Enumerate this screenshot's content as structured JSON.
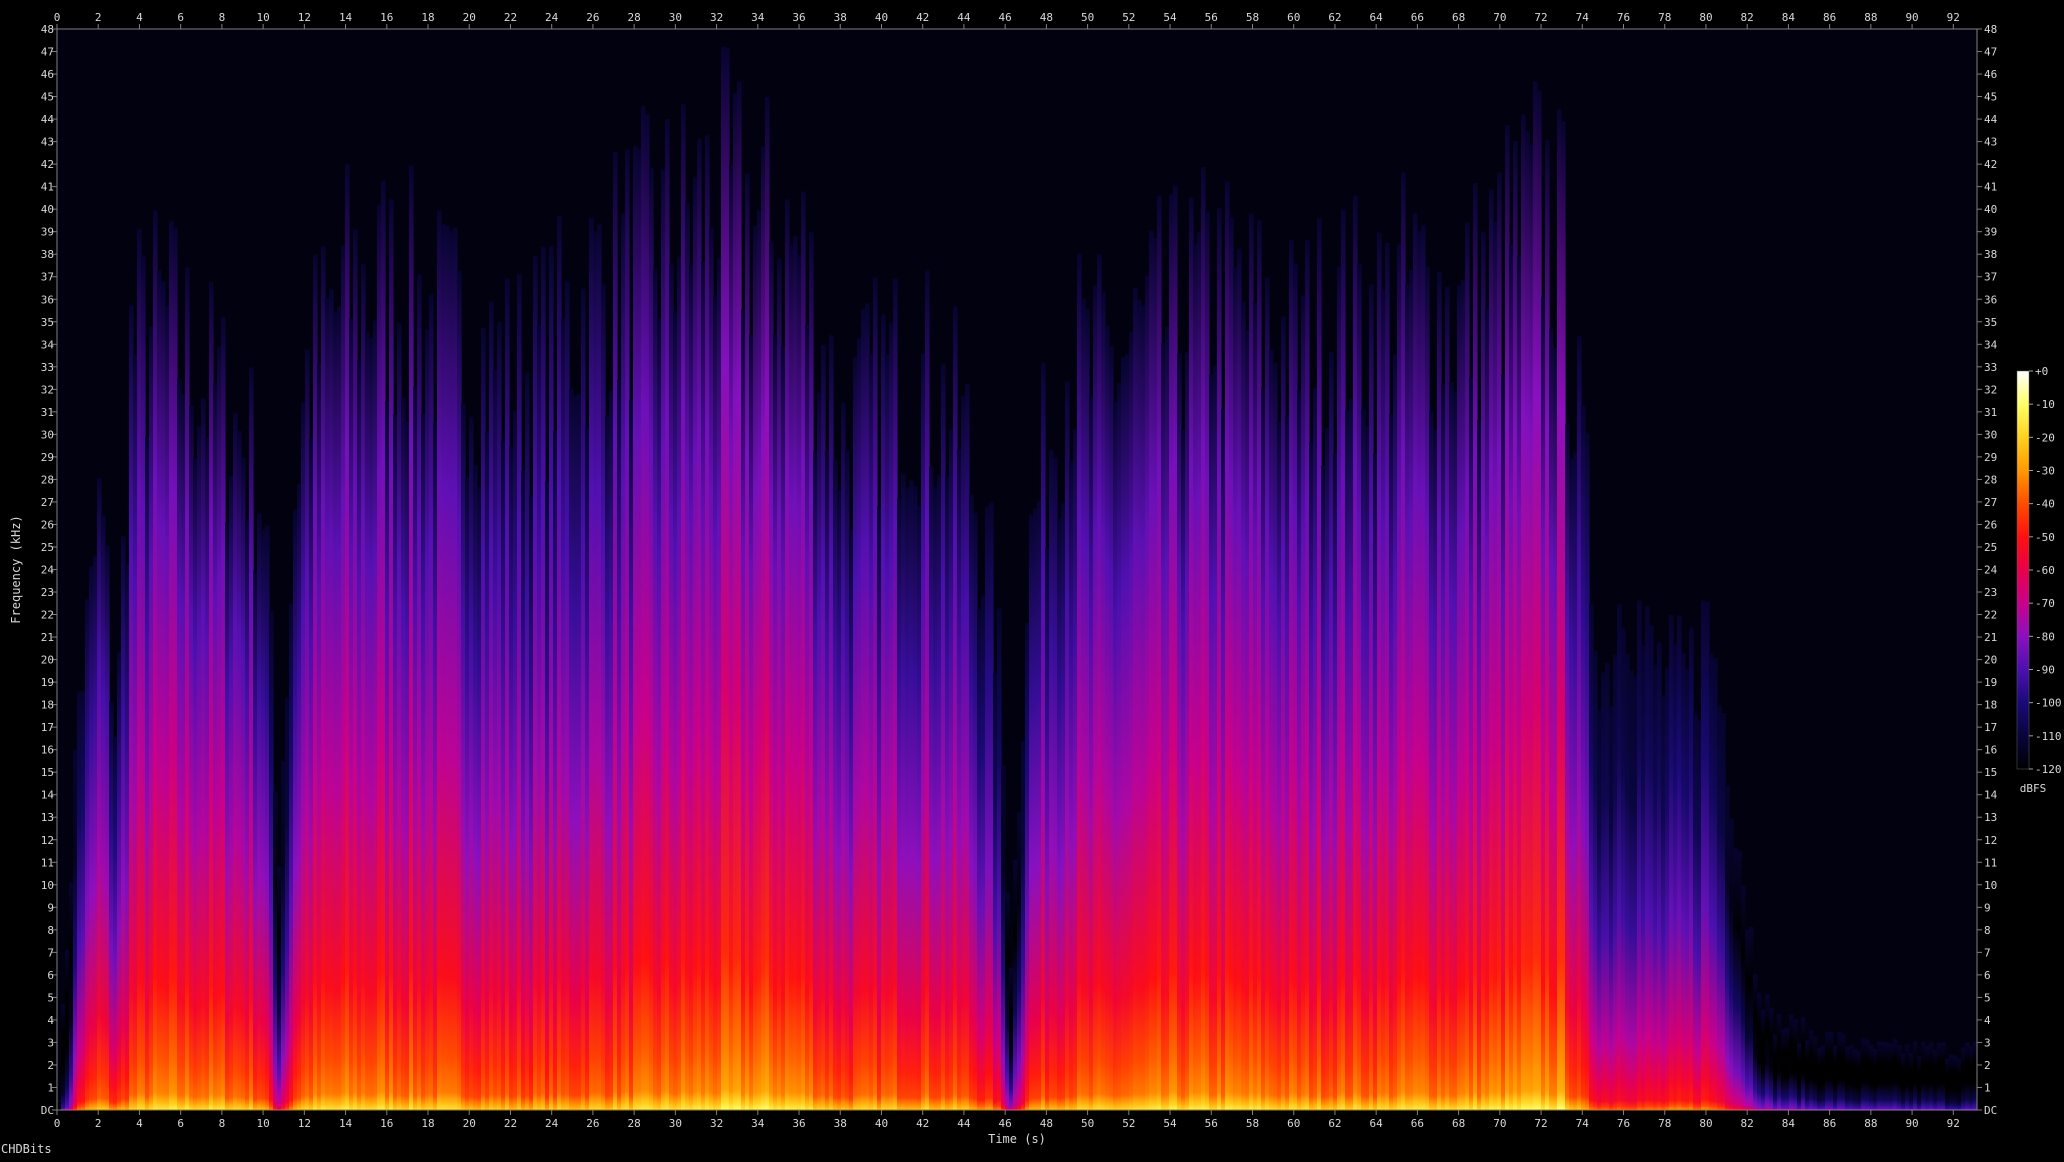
{
  "chart_data": {
    "type": "heatmap",
    "title": "",
    "xlabel": "Time (s)",
    "ylabel": "Frequency (kHz)",
    "xlim": [
      0,
      93
    ],
    "ylim": [
      0,
      48
    ],
    "x_ticks": [
      "0",
      "2",
      "4",
      "6",
      "8",
      "10",
      "12",
      "14",
      "16",
      "18",
      "20",
      "22",
      "24",
      "26",
      "28",
      "30",
      "32",
      "34",
      "36",
      "38",
      "40",
      "42",
      "44",
      "46",
      "48",
      "50",
      "52",
      "54",
      "56",
      "58",
      "60",
      "62",
      "64",
      "66",
      "68",
      "70",
      "72",
      "74",
      "76",
      "78",
      "80",
      "82",
      "84",
      "86",
      "88",
      "90",
      "92"
    ],
    "y_ticks": [
      "DC",
      "1",
      "2",
      "3",
      "4",
      "5",
      "6",
      "7",
      "8",
      "9",
      "10",
      "11",
      "12",
      "13",
      "14",
      "15",
      "16",
      "17",
      "18",
      "19",
      "20",
      "21",
      "22",
      "23",
      "24",
      "25",
      "26",
      "27",
      "28",
      "29",
      "30",
      "31",
      "32",
      "33",
      "34",
      "35",
      "36",
      "37",
      "38",
      "39",
      "40",
      "41",
      "42",
      "43",
      "44",
      "45",
      "46",
      "47",
      "48"
    ],
    "colorbar": {
      "label": "dBFS",
      "range": [
        -120,
        0
      ],
      "ticks": [
        "+0",
        "-10",
        "-20",
        "-30",
        "-40",
        "-50",
        "-60",
        "-70",
        "-80",
        "-90",
        "-100",
        "-110",
        "-120"
      ],
      "colors": [
        "#ffffff",
        "#ffff66",
        "#ffd21e",
        "#ff9a00",
        "#ff4c00",
        "#ff1010",
        "#e8004a",
        "#c8008c",
        "#8a10c0",
        "#4c10b0",
        "#1a0a78",
        "#08053a",
        "#000000"
      ]
    },
    "energy_profile": {
      "time_s": [
        0,
        1,
        1.5,
        2,
        2.8,
        3.5,
        5,
        7,
        9,
        10,
        10.6,
        11.5,
        12,
        14,
        16,
        18,
        20,
        22,
        24,
        26,
        28,
        30,
        32,
        34,
        36,
        38,
        40,
        42,
        44,
        45.5,
        46.2,
        47,
        48,
        49,
        50,
        52,
        54,
        56,
        58,
        60,
        62,
        64,
        66,
        68,
        70,
        72,
        73,
        74,
        75,
        76,
        77,
        78,
        79,
        80,
        81,
        82,
        83,
        85,
        88,
        90,
        93
      ],
      "top_khz": [
        0.4,
        14,
        16,
        20,
        12,
        25,
        26,
        24,
        22,
        20,
        8,
        21,
        24,
        27,
        27,
        26,
        25,
        24,
        25,
        27,
        28,
        29,
        30,
        29,
        28,
        22,
        24,
        24,
        22,
        16,
        5,
        18,
        22,
        25,
        24,
        25,
        26,
        27,
        26,
        25,
        26,
        26,
        27,
        26,
        28,
        30,
        28,
        20,
        14,
        18,
        15,
        14,
        14,
        16,
        12,
        6,
        3,
        2.5,
        2,
        2,
        2
      ],
      "level_db": [
        -118,
        -58,
        -52,
        -46,
        -54,
        -46,
        -42,
        -42,
        -44,
        -48,
        -78,
        -48,
        -44,
        -42,
        -42,
        -44,
        -46,
        -48,
        -48,
        -46,
        -44,
        -42,
        -40,
        -38,
        -40,
        -48,
        -46,
        -46,
        -48,
        -58,
        -85,
        -52,
        -48,
        -46,
        -46,
        -44,
        -42,
        -42,
        -42,
        -44,
        -44,
        -44,
        -42,
        -42,
        -40,
        -38,
        -38,
        -55,
        -62,
        -60,
        -62,
        -60,
        -58,
        -58,
        -66,
        -80,
        -90,
        -95,
        -98,
        -98,
        -100
      ]
    }
  },
  "brand": "CHDBits"
}
